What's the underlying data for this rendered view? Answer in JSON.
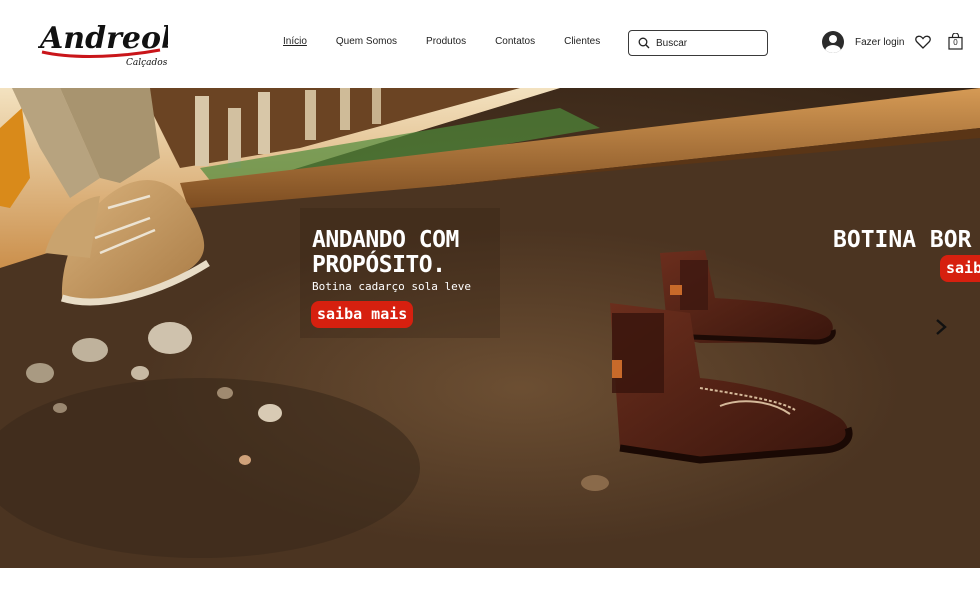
{
  "brand": {
    "name": "Andreola",
    "tagline": "Calçados"
  },
  "nav": {
    "items": [
      {
        "label": "Início",
        "active": true
      },
      {
        "label": "Quem Somos"
      },
      {
        "label": "Produtos"
      },
      {
        "label": "Contatos"
      },
      {
        "label": "Clientes"
      }
    ]
  },
  "search": {
    "placeholder": "Buscar",
    "icon": "search-icon"
  },
  "account": {
    "login_label": "Fazer login",
    "avatar_icon": "user-avatar-icon",
    "wishlist_icon": "heart-icon",
    "cart_icon": "shopping-bag-icon",
    "cart_count": "0"
  },
  "hero": {
    "slide": {
      "title": "ANDANDO COM PROPÓSITO.",
      "subtitle": "Botina cadarço sola leve",
      "cta_label": "saiba mais"
    },
    "next_slide": {
      "title": "BOTINA BOR",
      "cta_label": "saib"
    },
    "next_icon": "chevron-right-icon",
    "colors": {
      "cta": "#d6200f",
      "soil": "#4a3320",
      "rail": "#8a5a2a",
      "boot": "#4a1f14"
    }
  }
}
